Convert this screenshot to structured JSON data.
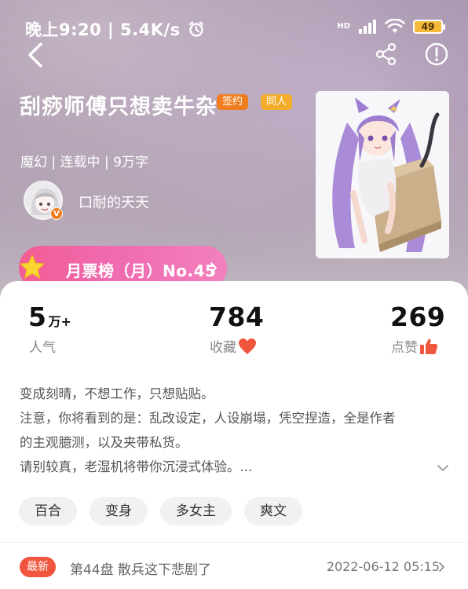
{
  "status_bar": {
    "time": "晚上9:20 | 5.4K/s",
    "network_label": "HD",
    "battery": "49"
  },
  "book": {
    "title": "刮痧师傅只想卖牛杂",
    "badges": [
      "签约",
      "同人"
    ],
    "meta": "魔幻 | 连载中 | 9万字",
    "author": "口耐的天天",
    "author_badge": "V"
  },
  "rank": {
    "label": "月票榜（月）No.45"
  },
  "stats": [
    {
      "value": "5",
      "unit": "万+",
      "label": "人气"
    },
    {
      "value": "784",
      "label": "收藏"
    },
    {
      "value": "269",
      "label": "点赞"
    }
  ],
  "intro": [
    "变成刻晴，不想工作，只想贴贴。",
    "注意，你将看到的是：乱改设定，人设崩塌，凭空捏造，全是作者",
    "的主观臆测，以及夹带私货。",
    "请别较真，老湿机将带你沉浸式体验。..."
  ],
  "tags": [
    "百合",
    "变身",
    "多女主",
    "爽文"
  ],
  "latest": {
    "badge": "最新",
    "chapter": "第44盘 散兵这下悲剧了",
    "time": "2022-06-12 05:15"
  },
  "colors": {
    "accent_orange": "#f07e21",
    "badge_yellow": "#f3ad2b",
    "rank_pink": "#f25d95",
    "latest_red": "#f2553d",
    "like_red": "#f0553d"
  }
}
